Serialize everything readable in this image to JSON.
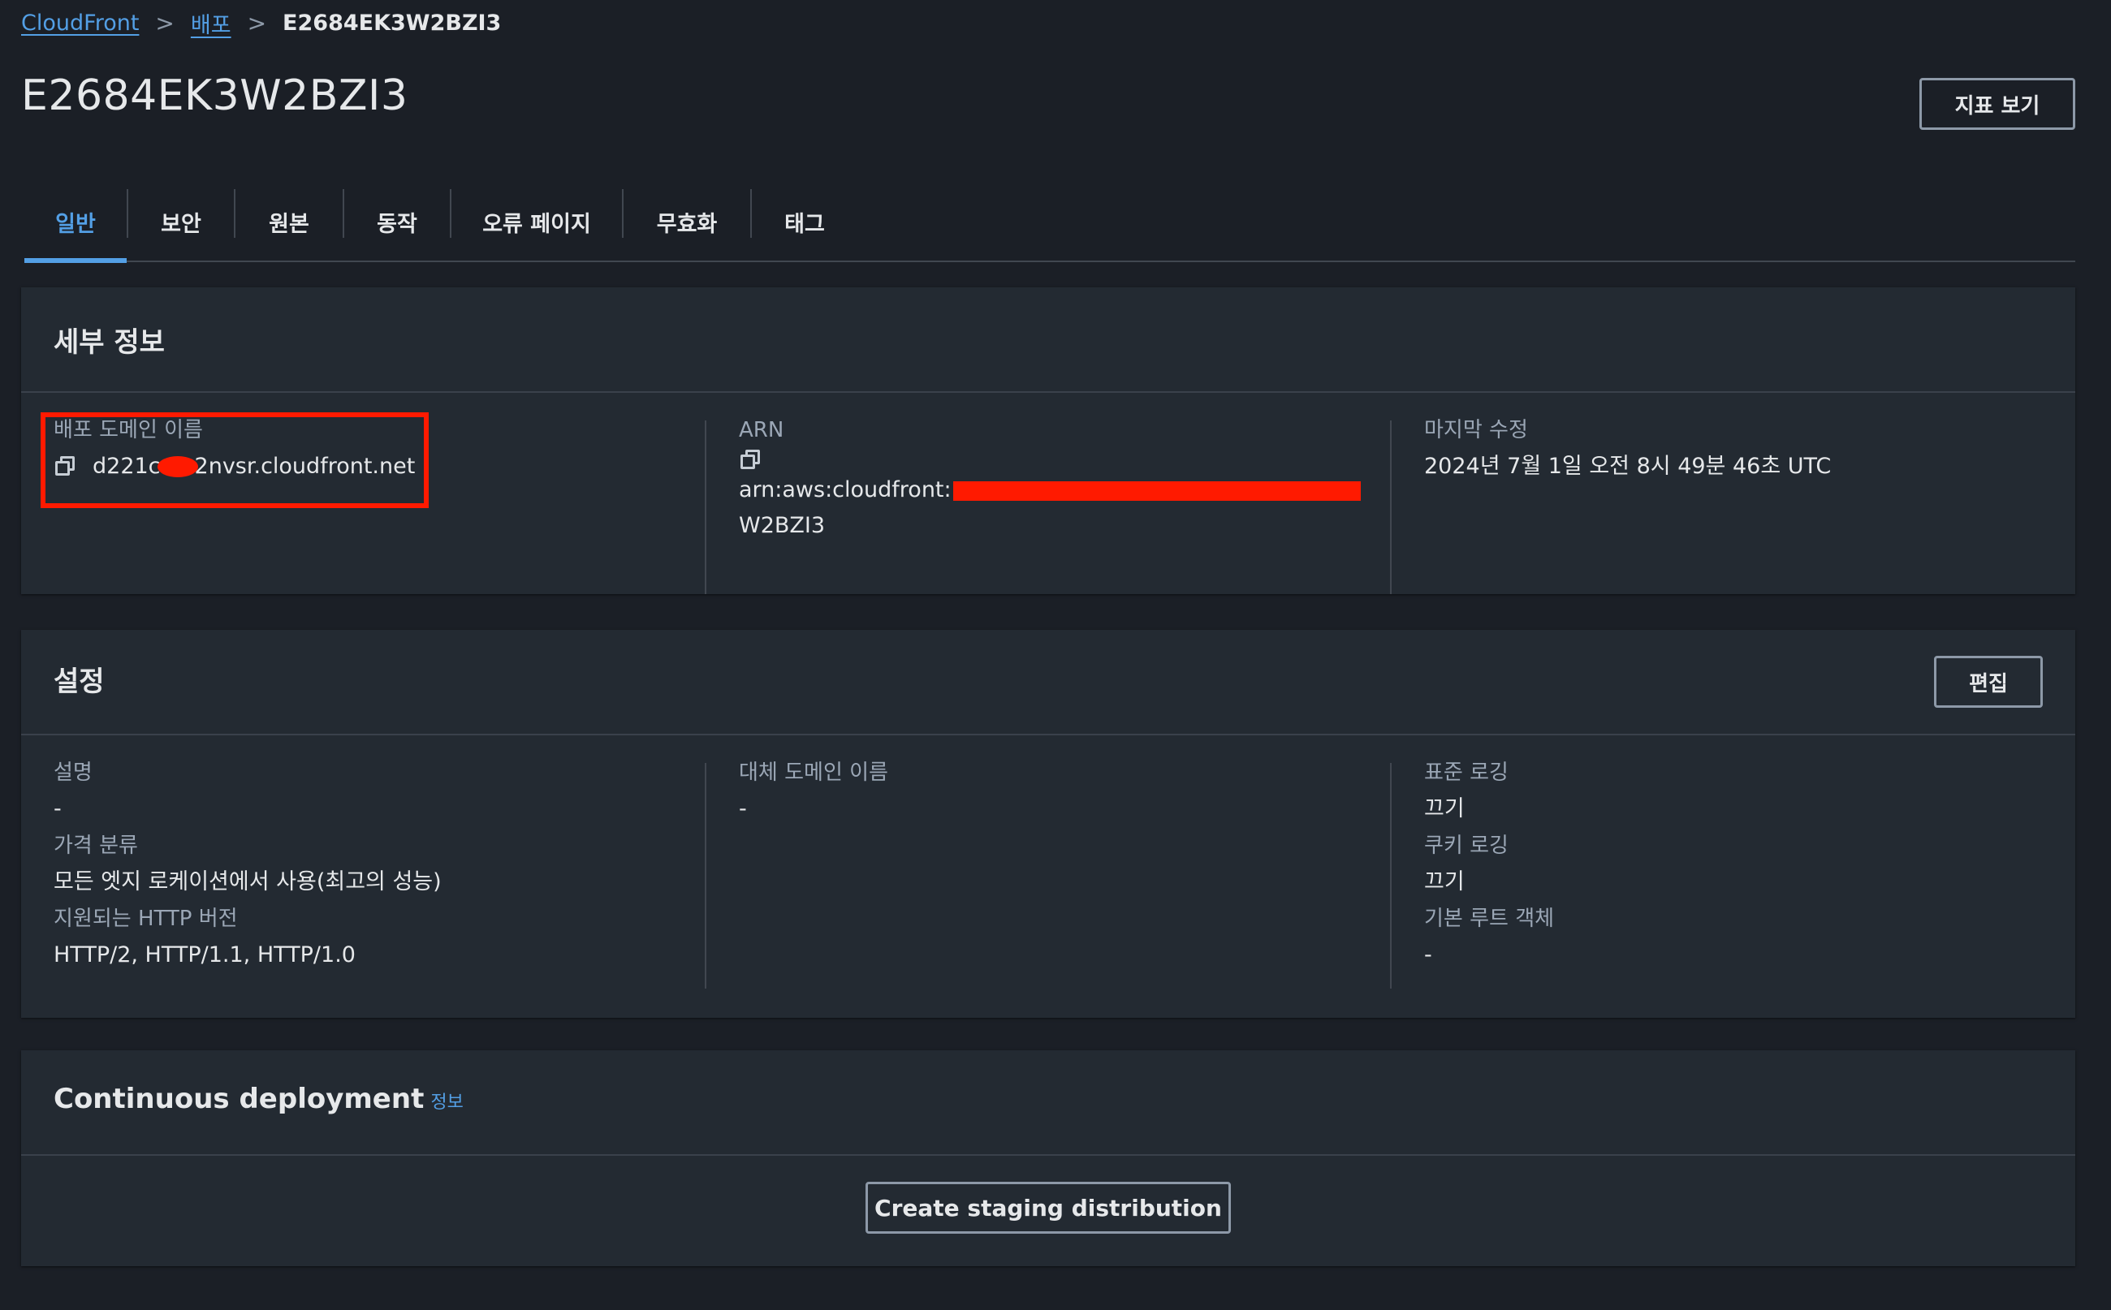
{
  "breadcrumb": {
    "root": "CloudFront",
    "parent": "배포",
    "current": "E2684EK3W2BZI3",
    "separator": ">"
  },
  "page": {
    "title": "E2684EK3W2BZI3",
    "metrics_button": "지표 보기"
  },
  "tabs": [
    {
      "label": "일반",
      "active": true
    },
    {
      "label": "보안",
      "active": false
    },
    {
      "label": "원본",
      "active": false
    },
    {
      "label": "동작",
      "active": false
    },
    {
      "label": "오류 페이지",
      "active": false
    },
    {
      "label": "무효화",
      "active": false
    },
    {
      "label": "태그",
      "active": false
    }
  ],
  "details": {
    "title": "세부 정보",
    "domain_label": "배포 도메인 이름",
    "domain_prefix": "d221c",
    "domain_suffix": "2nvsr.cloudfront.net",
    "arn_label": "ARN",
    "arn_prefix": "arn:aws:cloudfront:",
    "arn_suffix": "W2BZI3",
    "modified_label": "마지막 수정",
    "modified_value": "2024년 7월 1일 오전 8시 49분 46초 UTC"
  },
  "settings": {
    "title": "설정",
    "edit_button": "편집",
    "description_label": "설명",
    "description_value": "-",
    "price_class_label": "가격 분류",
    "price_class_value": "모든 엣지 로케이션에서 사용(최고의 성능)",
    "http_label": "지원되는 HTTP 버전",
    "http_value": "HTTP/2, HTTP/1.1, HTTP/1.0",
    "alt_domain_label": "대체 도메인 이름",
    "alt_domain_value": "-",
    "std_logging_label": "표준 로깅",
    "std_logging_value": "끄기",
    "cookie_logging_label": "쿠키 로깅",
    "cookie_logging_value": "끄기",
    "root_object_label": "기본 루트 객체",
    "root_object_value": "-"
  },
  "continuous": {
    "title": "Continuous deployment",
    "info_link": "정보",
    "staging_button": "Create staging distribution"
  },
  "colors": {
    "background": "#1b1f26",
    "panel": "#232a32",
    "accent": "#539fe5",
    "redaction": "#ff1a00"
  }
}
